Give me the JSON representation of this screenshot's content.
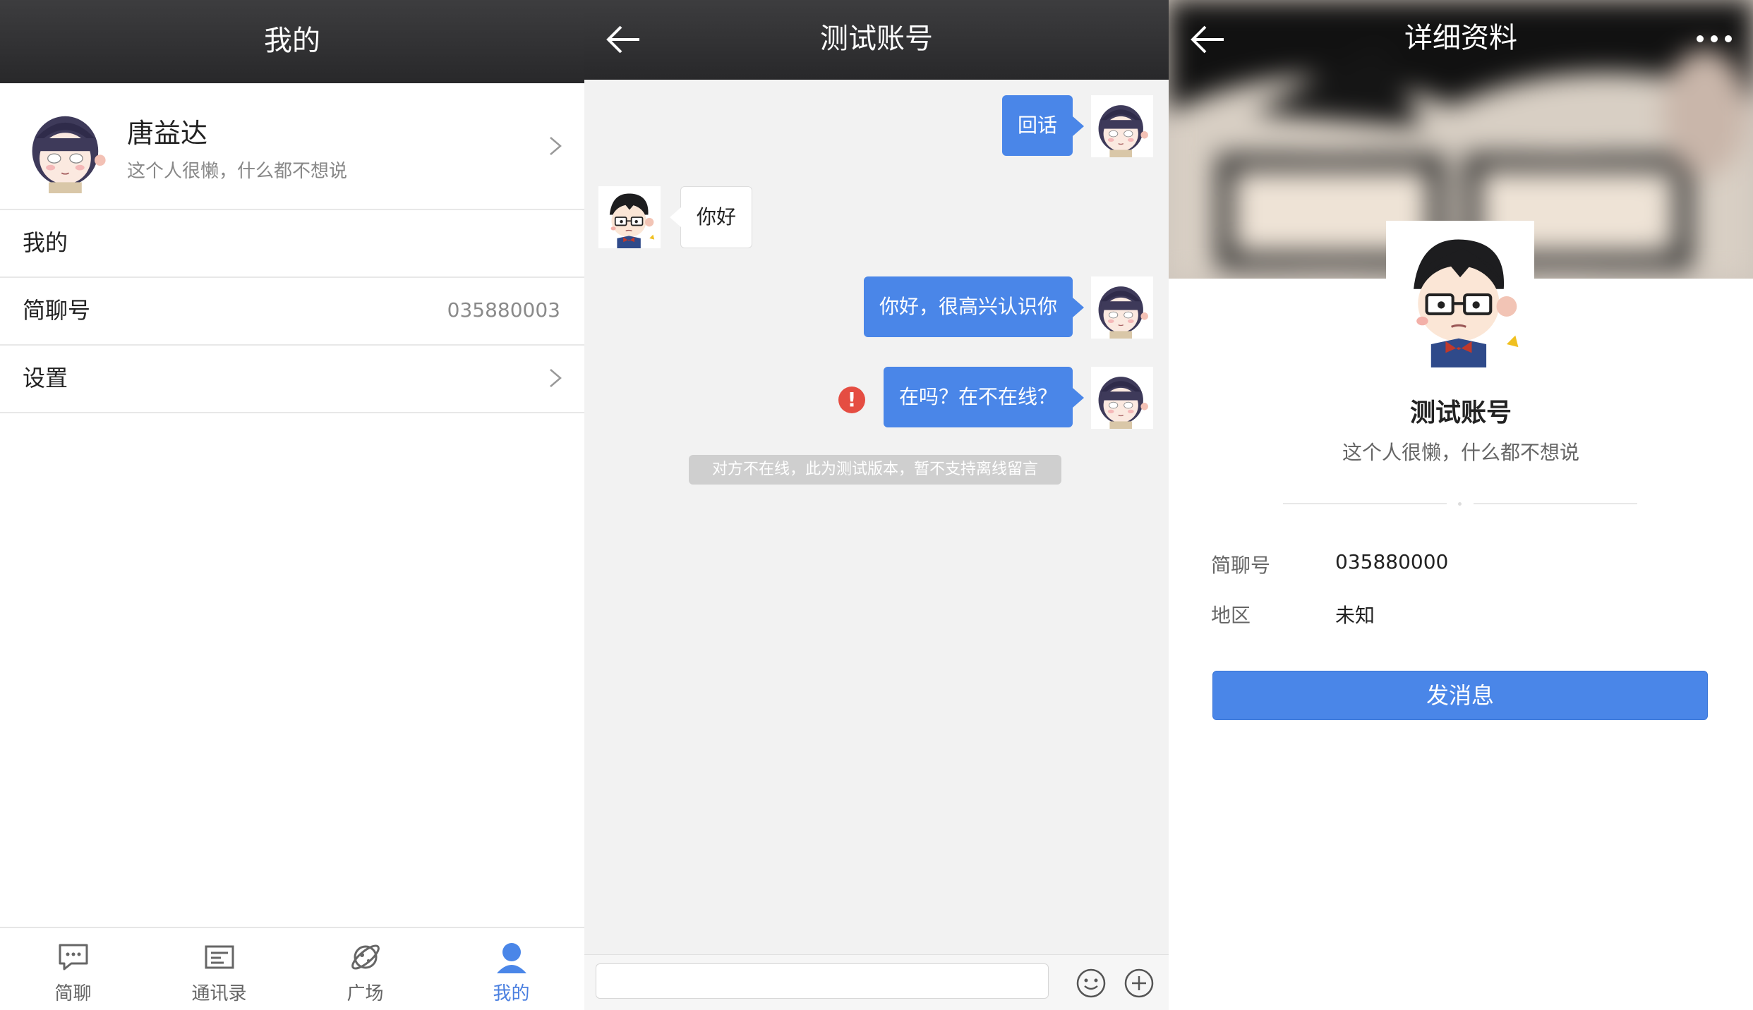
{
  "me": {
    "title": "我的",
    "name": "唐益达",
    "signature": "这个人很懒，什么都不想说",
    "rows": [
      {
        "label": "我的",
        "value": ""
      },
      {
        "label": "简聊号",
        "value": "035880003"
      },
      {
        "label": "设置",
        "value": ""
      }
    ],
    "tabs": [
      {
        "label": "简聊",
        "icon": "chat-icon"
      },
      {
        "label": "通讯录",
        "icon": "contacts-icon"
      },
      {
        "label": "广场",
        "icon": "planet-icon"
      },
      {
        "label": "我的",
        "icon": "user-icon"
      }
    ],
    "active_tab": "我的"
  },
  "chat": {
    "title": "测试账号",
    "messages": [
      {
        "direction": "out",
        "text": "回话"
      },
      {
        "direction": "in",
        "text": "你好"
      },
      {
        "direction": "out",
        "text": "你好，很高兴认识你"
      },
      {
        "direction": "out",
        "text": "在吗？在不在线？",
        "failed": true
      }
    ],
    "notice": "对方不在线，此为测试版本，暂不支持离线留言",
    "input_value": ""
  },
  "profile": {
    "title": "详细资料",
    "name": "测试账号",
    "signature": "这个人很懒，什么都不想说",
    "fields": [
      {
        "key": "简聊号",
        "value": "035880000"
      },
      {
        "key": "地区",
        "value": "未知"
      }
    ],
    "send_button": "发消息"
  },
  "colors": {
    "accent": "#4a86e8",
    "topbar": "#333335",
    "error": "#e54d42"
  }
}
